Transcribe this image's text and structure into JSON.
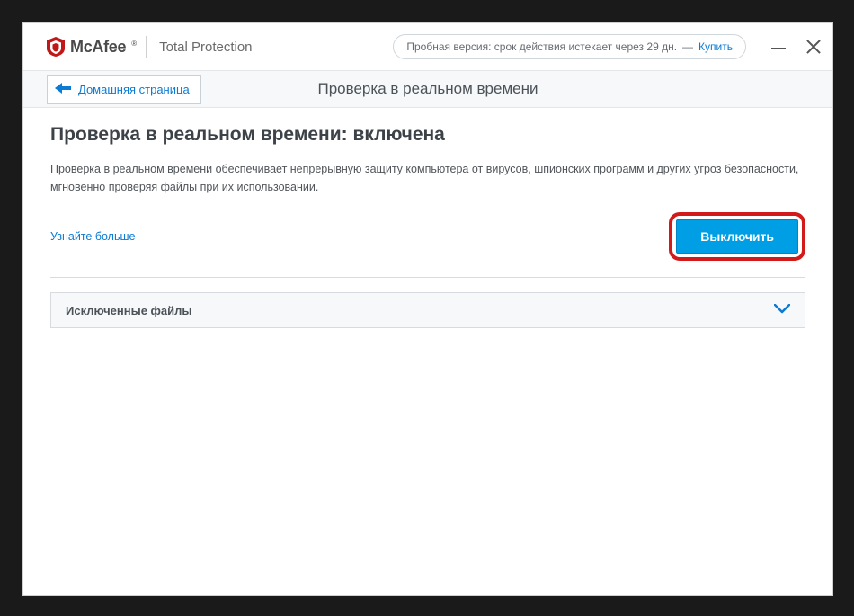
{
  "header": {
    "brand_name": "McAfee",
    "brand_subtitle": "Total Protection",
    "trial_text": "Пробная версия: срок действия истекает через 29 дн.",
    "trial_separator": "—",
    "buy_label": "Купить"
  },
  "nav": {
    "back_label": "Домашняя страница",
    "title": "Проверка в реальном времени"
  },
  "page": {
    "heading": "Проверка в реальном времени: включена",
    "description": "Проверка в реальном времени обеспечивает непрерывную защиту компьютера от вирусов, шпионских программ и других угроз безопасности, мгновенно проверяя файлы при их использовании.",
    "learn_more": "Узнайте больше",
    "disable_button": "Выключить"
  },
  "accordion": {
    "excluded_files_label": "Исключенные файлы"
  },
  "colors": {
    "accent_blue": "#009ee5",
    "link_blue": "#0b7bd4",
    "callout_red": "#d21a1a"
  }
}
